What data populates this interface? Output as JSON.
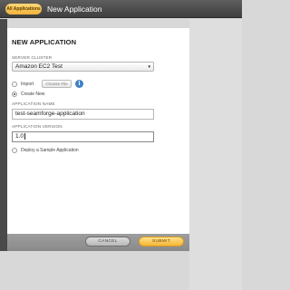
{
  "header": {
    "breadcrumb": "All Applications",
    "title": "New Application"
  },
  "form": {
    "title": "NEW APPLICATION",
    "server_cluster_label": "SERVER CLUSTER",
    "server_cluster_value": "Amazon EC2 Test",
    "import_label": "Import",
    "choose_file_label": "Choose File",
    "info_glyph": "i",
    "create_new_label": "Create New",
    "create_new_selected": true,
    "app_name_label": "APPLICATION NAME",
    "app_name_value": "test-seamforge-application",
    "app_version_label": "APPLICATION VERSION",
    "app_version_value": "1.0",
    "deploy_sample_label": "Deploy a Sample Application"
  },
  "footer": {
    "cancel_label": "CANCEL",
    "submit_label": "SUBMIT"
  },
  "icons": {
    "select": "chevron-down-icon",
    "info": "info-icon"
  },
  "colors": {
    "accent": "#f6b637",
    "header": "#4a4a4a",
    "info": "#3e7fc4"
  }
}
